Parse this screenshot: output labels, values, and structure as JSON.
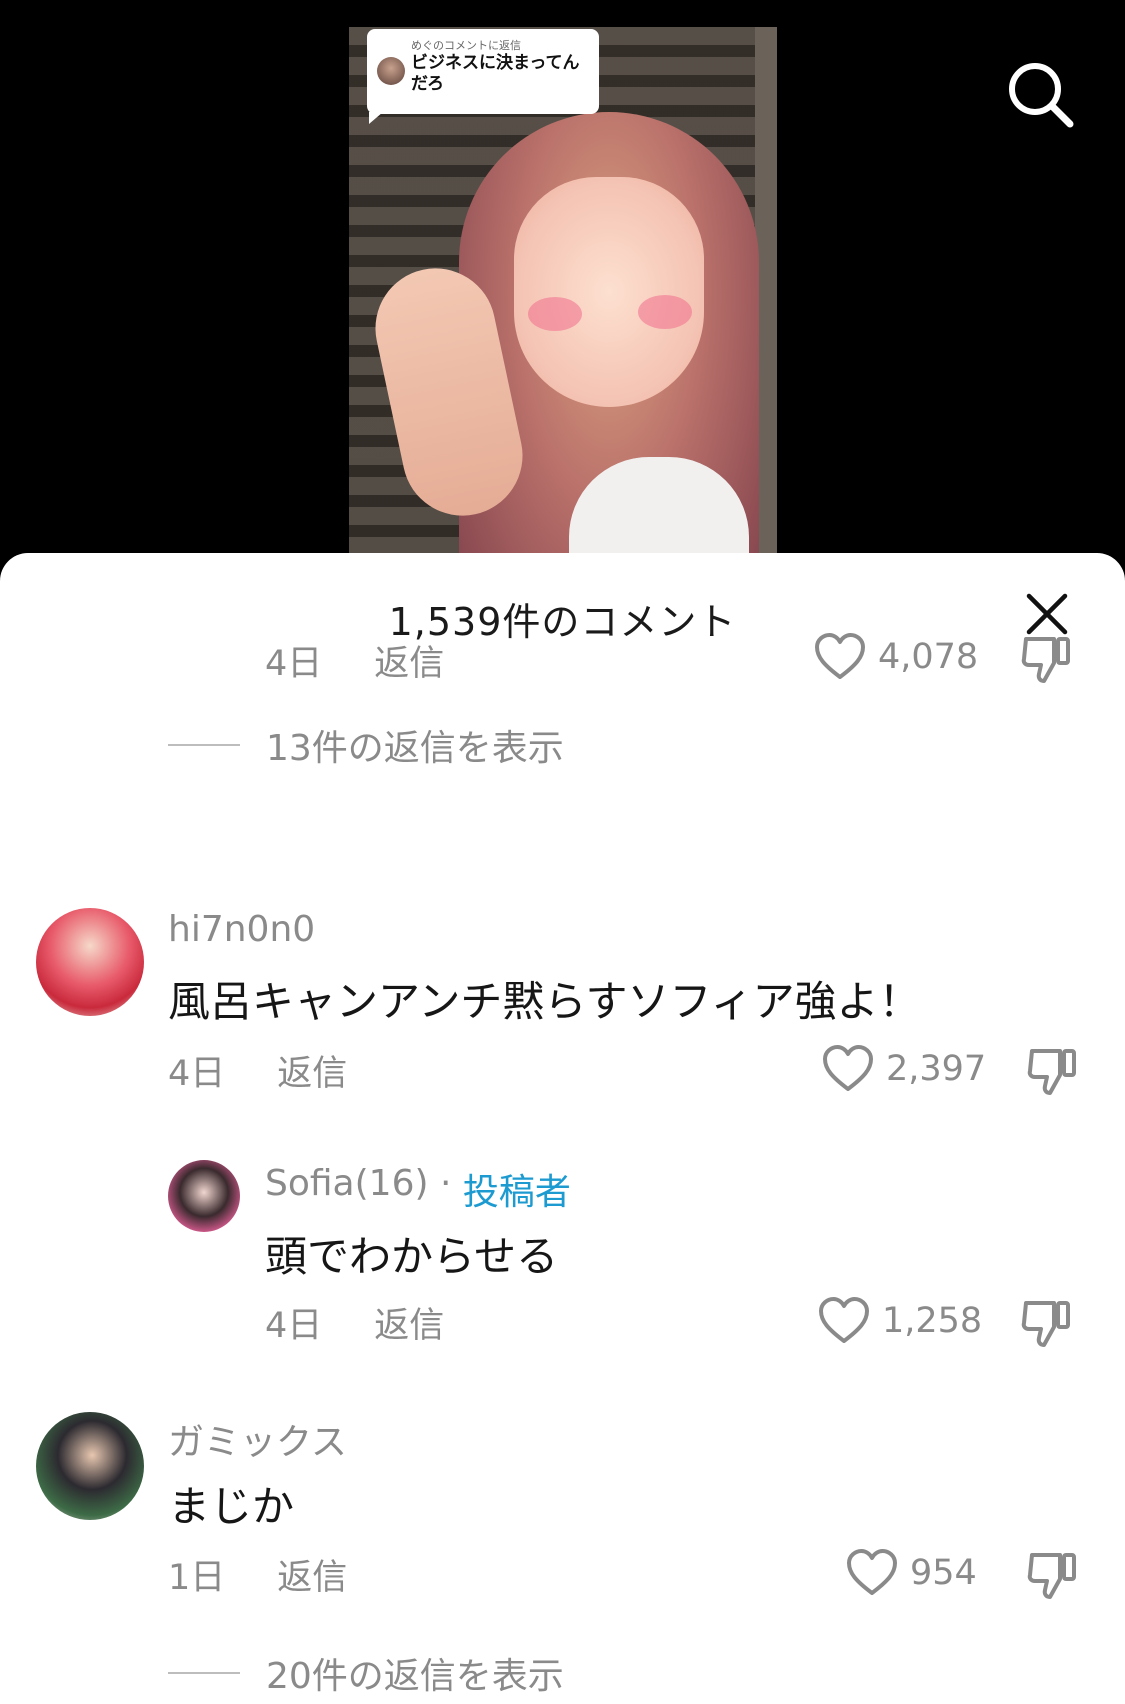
{
  "video": {
    "reply_bubble": {
      "small": "めぐのコメントに返信",
      "main": "ビジネスに決まってんだろ"
    }
  },
  "sheet": {
    "title": "1,539件のコメント"
  },
  "top_comment": {
    "time": "4日",
    "reply": "返信",
    "likes": "4,078"
  },
  "view_replies_1": "13件の返信を表示",
  "comments": [
    {
      "username": "hi7n0n0",
      "text": "風呂キャンアンチ黙らすソフィア強よ！",
      "time": "4日",
      "reply": "返信",
      "likes": "2,397"
    },
    {
      "username": "Sofia(16)",
      "separator": " · ",
      "badge": "投稿者",
      "text": "頭でわからせる",
      "time": "4日",
      "reply": "返信",
      "likes": "1,258"
    },
    {
      "username": "ガミックス",
      "text": "まじか",
      "time": "1日",
      "reply": "返信",
      "likes": "954"
    }
  ],
  "view_replies_2": "20件の返信を表示",
  "colors": {
    "author_badge": "#1d9bd1",
    "meta_gray": "#8a8a8a",
    "sheet_bg": "#ffffff",
    "top_bg": "#000000"
  }
}
